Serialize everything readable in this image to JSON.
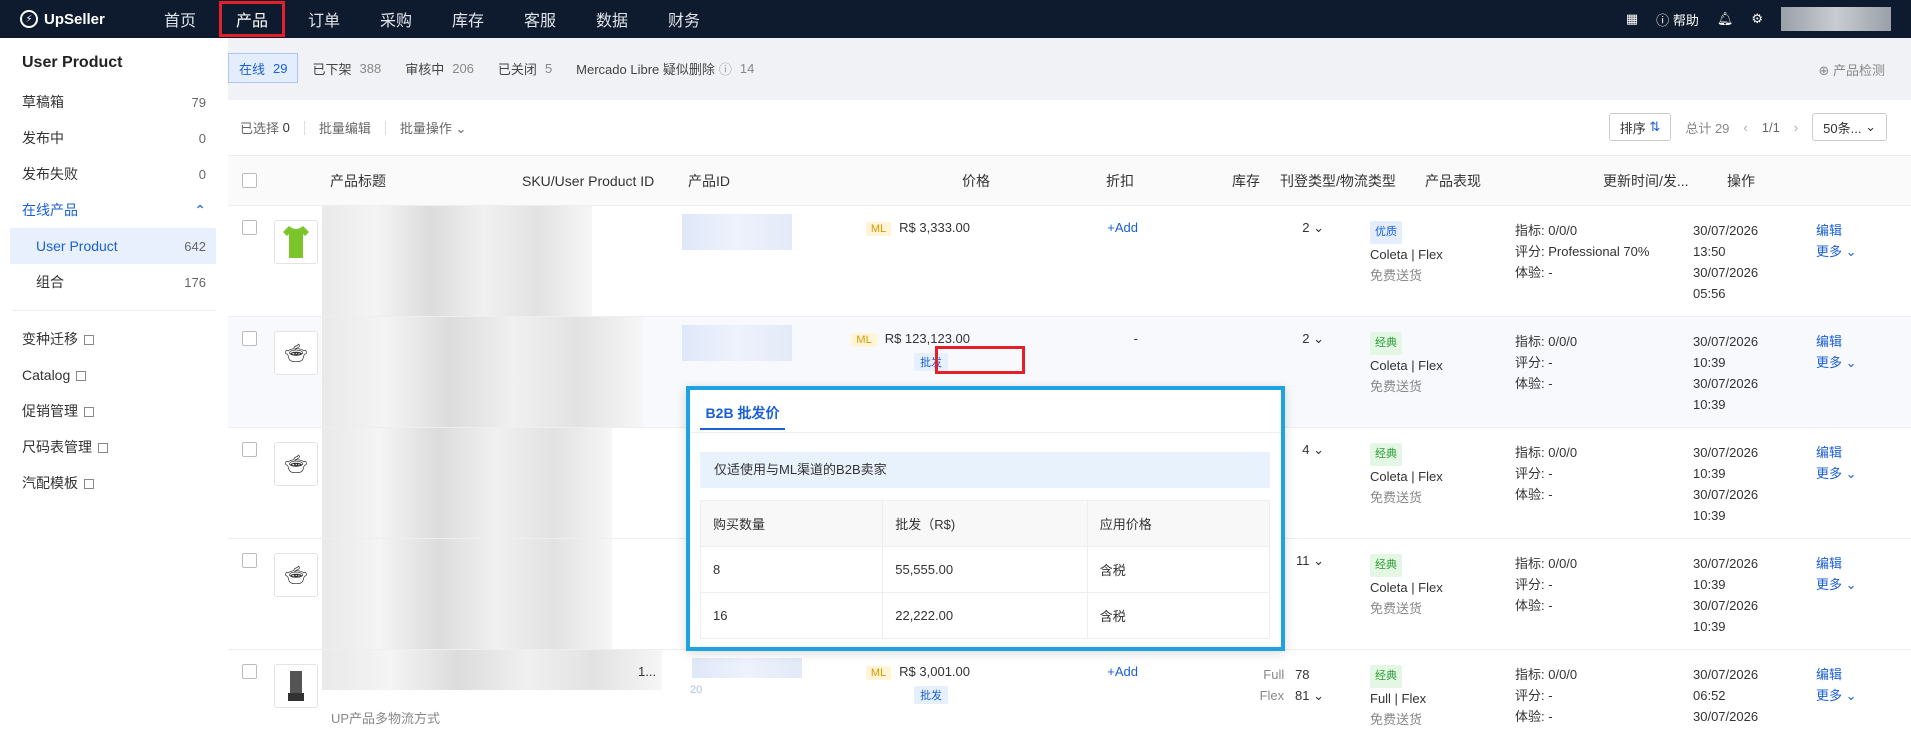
{
  "topbar": {
    "brand": "UpSeller",
    "nav": [
      "首页",
      "产品",
      "订单",
      "采购",
      "库存",
      "客服",
      "数据",
      "财务"
    ],
    "active_nav": "产品",
    "help": "帮助"
  },
  "sidebar": {
    "title": "User Product",
    "items": [
      {
        "label": "草稿箱",
        "count": "79"
      },
      {
        "label": "发布中",
        "count": "0"
      },
      {
        "label": "发布失败",
        "count": "0"
      },
      {
        "label": "在线产品",
        "count": ""
      },
      {
        "label": "User Product",
        "count": "642"
      },
      {
        "label": "组合",
        "count": "176"
      }
    ],
    "links": [
      "变种迁移",
      "Catalog",
      "促销管理",
      "尺码表管理",
      "汽配模板"
    ]
  },
  "tabs": [
    {
      "label": "在线",
      "count": "29"
    },
    {
      "label": "已下架",
      "count": "388"
    },
    {
      "label": "审核中",
      "count": "206"
    },
    {
      "label": "已关闭",
      "count": "5"
    },
    {
      "label": "Mercado Libre 疑似删除",
      "count": "14"
    }
  ],
  "detect_label": "产品检测",
  "actionbar": {
    "selected": "已选择",
    "selected_count": "0",
    "bulk_edit": "批量编辑",
    "bulk_ops": "批量操作",
    "sort": "排序",
    "total": "总计 29",
    "page": "1/1",
    "page_size": "50条..."
  },
  "columns": [
    "产品标题",
    "SKU/User Product ID",
    "产品ID",
    "价格",
    "折扣",
    "库存",
    "刊登类型/物流类型",
    "产品表现",
    "更新时间/发...",
    "操作"
  ],
  "rows": [
    {
      "price_tag": "ML",
      "price": "R$ 3,333.00",
      "wholesale": "",
      "discount": "+Add",
      "stock": "2",
      "listing": "优质",
      "logistics": "Coleta | Flex",
      "shipping": "免费送货",
      "perf1": "指标: 0/0/0",
      "perf2": "评分: Professional 70%",
      "perf3": "体验: -",
      "time1": "30/07/2026",
      "time2": "13:50",
      "time3": "30/07/2026",
      "time4": "05:56",
      "edit": "编辑",
      "more": "更多"
    },
    {
      "price_tag": "ML",
      "price": "R$ 123,123.00",
      "wholesale": "批发",
      "discount": "-",
      "stock": "2",
      "listing": "经典",
      "logistics": "Coleta | Flex",
      "shipping": "免费送货",
      "perf1": "指标: 0/0/0",
      "perf2": "评分: -",
      "perf3": "体验: -",
      "time1": "30/07/2026",
      "time2": "10:39",
      "time3": "30/07/2026",
      "time4": "10:39",
      "edit": "编辑",
      "more": "更多"
    },
    {
      "price_tag": "",
      "price": "",
      "wholesale": "",
      "discount": "",
      "stock": "4",
      "listing": "经典",
      "logistics": "Coleta | Flex",
      "shipping": "免费送货",
      "perf1": "指标: 0/0/0",
      "perf2": "评分: -",
      "perf3": "体验: -",
      "time1": "30/07/2026",
      "time2": "10:39",
      "time3": "30/07/2026",
      "time4": "10:39",
      "edit": "编辑",
      "more": "更多"
    },
    {
      "price_tag": "",
      "price": "",
      "wholesale": "",
      "discount": "",
      "stock": "11",
      "listing": "经典",
      "logistics": "Coleta | Flex",
      "shipping": "免费送货",
      "perf1": "指标: 0/0/0",
      "perf2": "评分: -",
      "perf3": "体验: -",
      "time1": "30/07/2026",
      "time2": "10:39",
      "time3": "30/07/2026",
      "time4": "10:39",
      "edit": "编辑",
      "more": "更多"
    },
    {
      "price_tag": "ML",
      "price": "R$ 3,001.00",
      "wholesale": "批发",
      "discount": "+Add",
      "stock_label1": "Full",
      "stock": "78",
      "stock_label2": "Flex",
      "stock2": "81",
      "listing": "经典",
      "logistics": "Full | Flex",
      "shipping": "免费送货",
      "perf1": "指标: 0/0/0",
      "perf2": "评分: -",
      "perf3": "体验: -",
      "time1": "30/07/2026",
      "time2": "06:52",
      "time3": "30/07/2026",
      "time4": "",
      "edit": "编辑",
      "more": "更多",
      "sku_suffix": "1...",
      "pid_suffix": "20",
      "title_note": "UP产品多物流方式"
    }
  ],
  "popup": {
    "tab": "B2B 批发价",
    "note": "仅适使用与ML渠道的B2B卖家",
    "headers": [
      "购买数量",
      "批发（R$)",
      "应用价格"
    ],
    "rows": [
      [
        "8",
        "55,555.00",
        "含税"
      ],
      [
        "16",
        "22,222.00",
        "含税"
      ]
    ]
  }
}
